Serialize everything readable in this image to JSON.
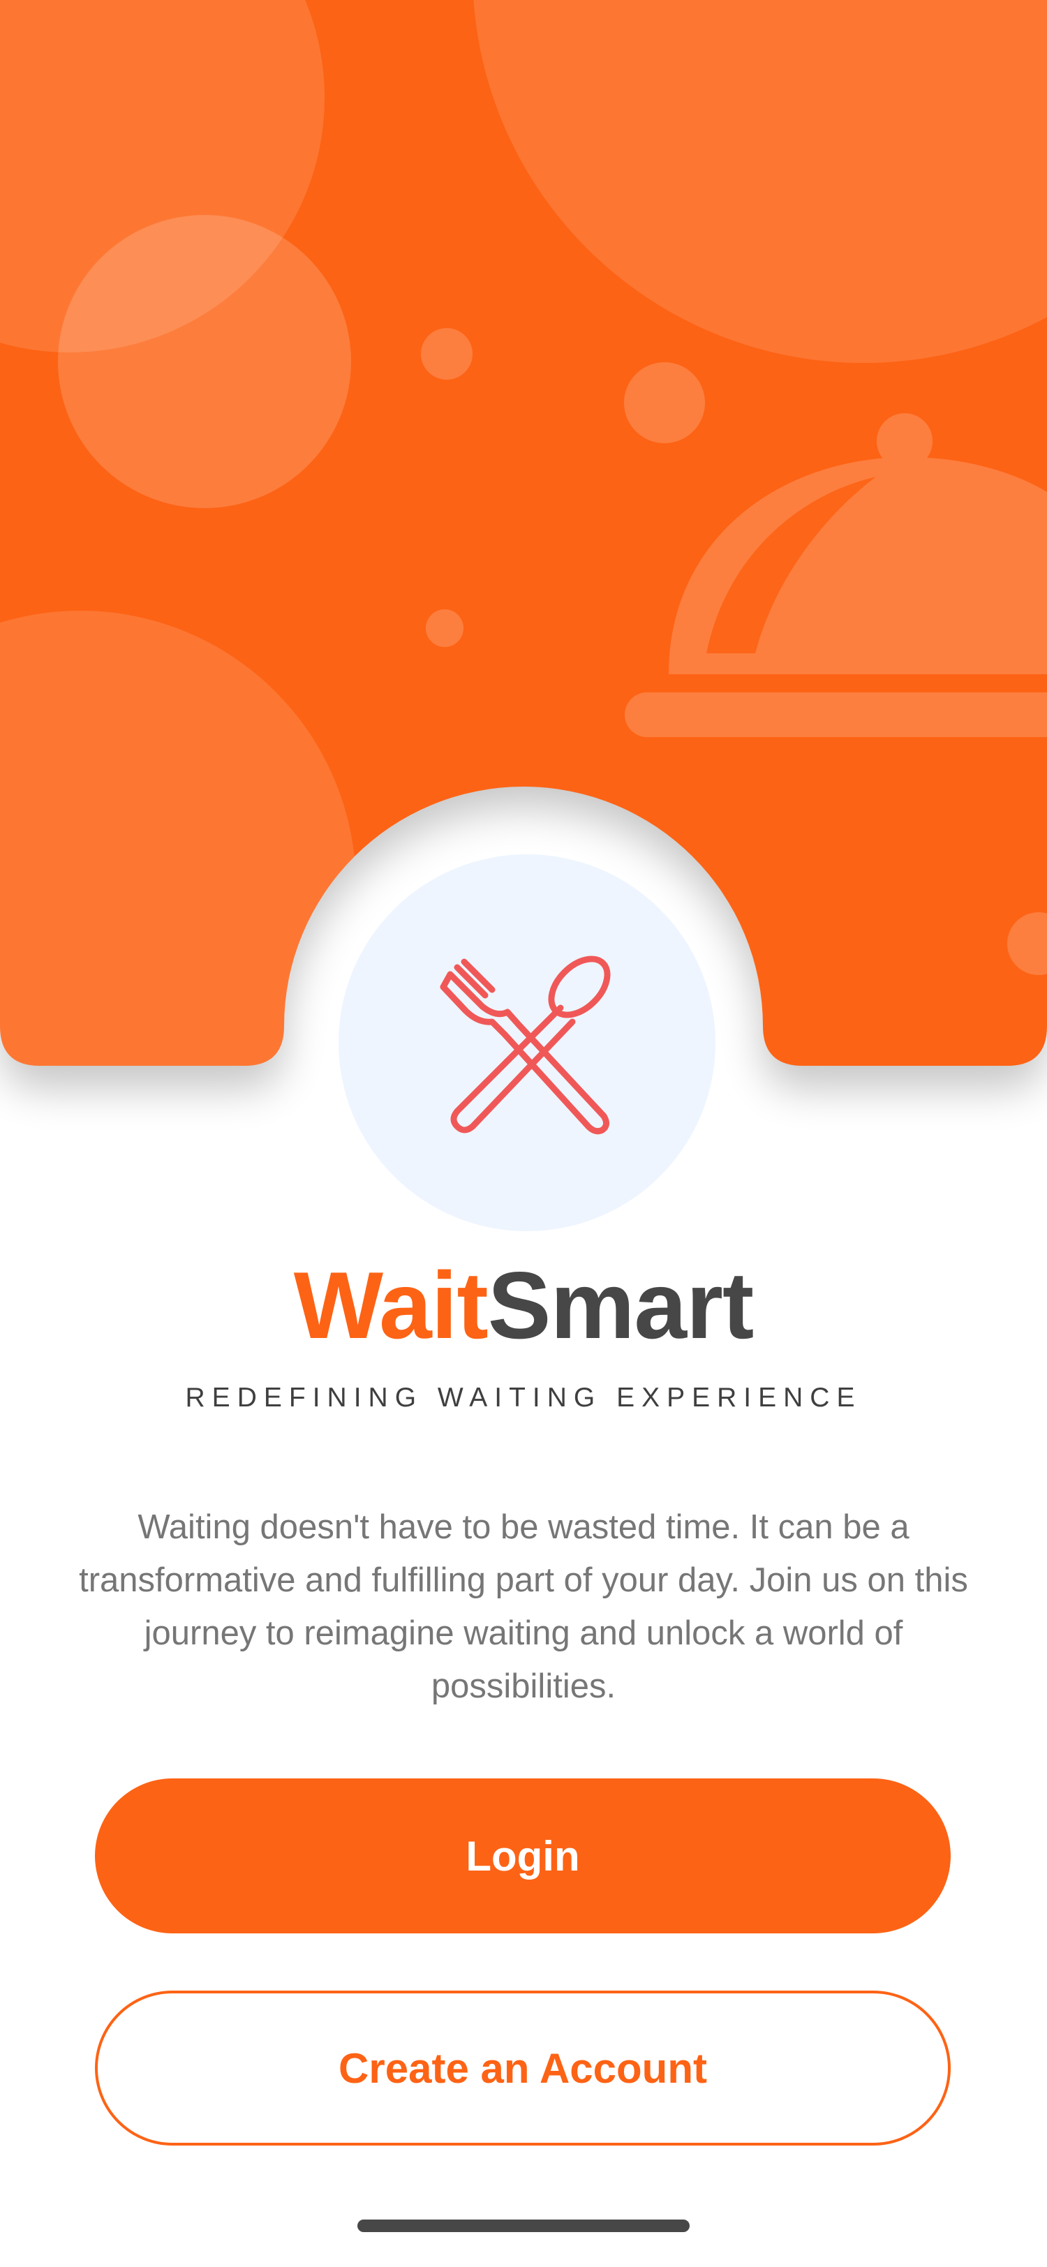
{
  "app": {
    "brand_part1": "Wait",
    "brand_part2": "Smart",
    "tagline": "REDEFINING WAITING EXPERIENCE",
    "description": "Waiting doesn't have to be wasted time. It can be a transformative and fulfilling part of your day. Join us on this journey to reimagine waiting and unlock a world of possibilities."
  },
  "actions": {
    "login_label": "Login",
    "create_account_label": "Create an Account"
  },
  "icons": {
    "hero_decoration": "food-cloche-icon",
    "logo": "fork-spoon-icon"
  },
  "colors": {
    "brand_orange": "#fd6315",
    "brand_dark": "#474747",
    "logo_icon": "#f05858",
    "logo_background": "#eef5ff"
  }
}
